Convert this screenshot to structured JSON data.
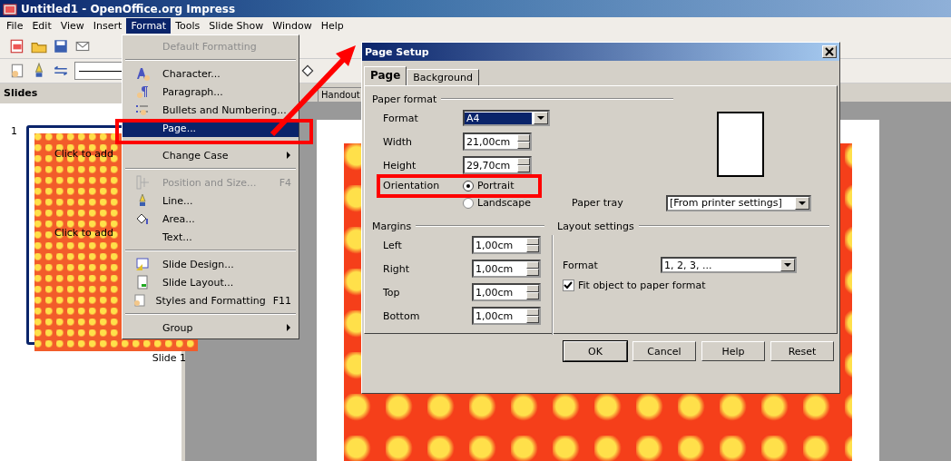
{
  "window": {
    "title": "Untitled1 - OpenOffice.org Impress"
  },
  "menubar": [
    {
      "label": "File",
      "selected": false
    },
    {
      "label": "Edit",
      "selected": false
    },
    {
      "label": "View",
      "selected": false
    },
    {
      "label": "Insert",
      "selected": false
    },
    {
      "label": "Format",
      "selected": true
    },
    {
      "label": "Tools",
      "selected": false
    },
    {
      "label": "Slide Show",
      "selected": false
    },
    {
      "label": "Window",
      "selected": false
    },
    {
      "label": "Help",
      "selected": false
    }
  ],
  "format_menu": [
    {
      "kind": "item",
      "label": "Default Formatting",
      "disabled": true,
      "selected": false
    },
    {
      "kind": "separator"
    },
    {
      "kind": "item",
      "label": "Character...",
      "disabled": false,
      "selected": false
    },
    {
      "kind": "item",
      "label": "Paragraph...",
      "disabled": false,
      "selected": false
    },
    {
      "kind": "item",
      "label": "Bullets and Numbering...",
      "disabled": false,
      "selected": false
    },
    {
      "kind": "item",
      "label": "Page...",
      "disabled": false,
      "selected": true
    },
    {
      "kind": "separator"
    },
    {
      "kind": "item",
      "label": "Change Case",
      "disabled": false,
      "selected": false,
      "submenu": true
    },
    {
      "kind": "separator"
    },
    {
      "kind": "item",
      "label": "Position and Size...",
      "shortcut": "F4",
      "disabled": true,
      "selected": false
    },
    {
      "kind": "item",
      "label": "Line...",
      "disabled": false,
      "selected": false
    },
    {
      "kind": "item",
      "label": "Area...",
      "disabled": false,
      "selected": false
    },
    {
      "kind": "item",
      "label": "Text...",
      "disabled": false,
      "selected": false
    },
    {
      "kind": "separator"
    },
    {
      "kind": "item",
      "label": "Slide Design...",
      "disabled": false,
      "selected": false
    },
    {
      "kind": "item",
      "label": "Slide Layout...",
      "disabled": false,
      "selected": false
    },
    {
      "kind": "item",
      "label": "Styles and Formatting",
      "shortcut": "F11",
      "disabled": false,
      "selected": false
    },
    {
      "kind": "separator"
    },
    {
      "kind": "item",
      "label": "Group",
      "disabled": false,
      "selected": false,
      "submenu": true
    }
  ],
  "slides_panel": {
    "title": "Slides",
    "slides": [
      {
        "number": "1",
        "caption": "Slide 1",
        "selected": true,
        "placeholders": [
          "Click to add",
          "Click to add"
        ]
      }
    ]
  },
  "view_tabs": [
    {
      "label": "Handout",
      "selected": false
    }
  ],
  "dialog": {
    "title": "Page Setup",
    "tabs": [
      {
        "label": "Page",
        "selected": true
      },
      {
        "label": "Background",
        "selected": false
      }
    ],
    "paper_format": {
      "heading": "Paper format",
      "format_label": "Format",
      "format": "A4",
      "width_label": "Width",
      "width": "21,00cm",
      "height_label": "Height",
      "height": "29,70cm",
      "orientation_label": "Orientation",
      "orientations": [
        {
          "label": "Portrait",
          "selected": true
        },
        {
          "label": "Landscape",
          "selected": false
        }
      ],
      "paper_tray_label": "Paper tray",
      "paper_tray": "[From printer settings]"
    },
    "margins": {
      "heading": "Margins",
      "fields": [
        {
          "label": "Left",
          "value": "1,00cm"
        },
        {
          "label": "Right",
          "value": "1,00cm"
        },
        {
          "label": "Top",
          "value": "1,00cm"
        },
        {
          "label": "Bottom",
          "value": "1,00cm"
        }
      ]
    },
    "layout_settings": {
      "heading": "Layout settings",
      "format_label": "Format",
      "format": "1, 2, 3, ...",
      "fit_label": "Fit object to paper format",
      "fit_checked": true
    },
    "buttons": [
      "OK",
      "Cancel",
      "Help",
      "Reset"
    ]
  }
}
